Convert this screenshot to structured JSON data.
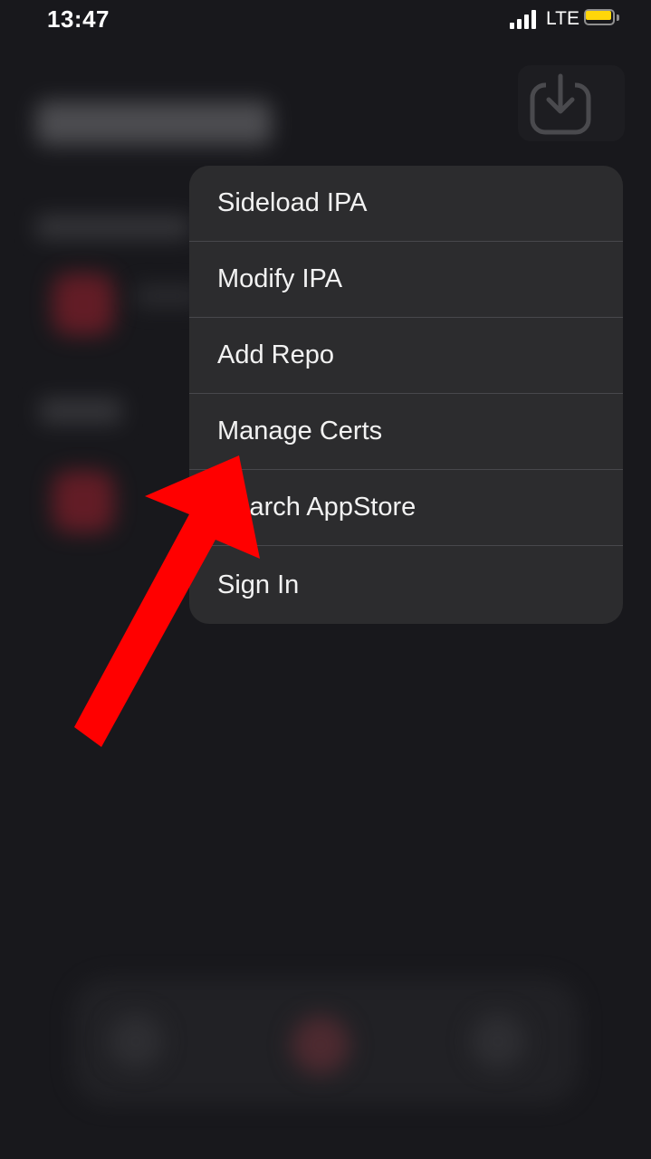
{
  "status_bar": {
    "time": "13:47",
    "network": "LTE",
    "signal_icon": "cellular-signal-icon",
    "battery_icon": "battery-icon",
    "battery_color": "#ffd60a"
  },
  "header": {
    "download_icon": "download-tray-icon"
  },
  "menu": {
    "items": [
      {
        "label": "Sideload IPA"
      },
      {
        "label": "Modify IPA"
      },
      {
        "label": "Add Repo"
      },
      {
        "label": "Manage Certs"
      },
      {
        "label": "Search AppStore"
      },
      {
        "label": "Sign In"
      }
    ]
  },
  "annotation": {
    "arrow_color": "#ff0000",
    "arrow_icon": "red-arrow-icon"
  }
}
